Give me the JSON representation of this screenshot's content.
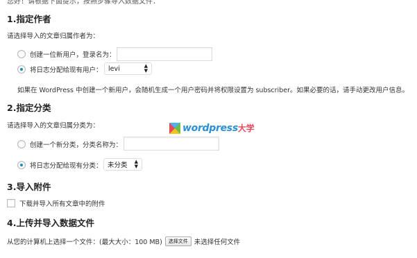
{
  "intro_text": "您好！请根据下面提示，按照步骤导入数据文件：",
  "section1": {
    "title": "1.指定作者",
    "prompt": "请选择导入的文章归属作者为：",
    "option_new_label": "创建一位新用户，登录名为：",
    "option_existing_label": "将日志分配给现有用户：",
    "existing_user_value": "levi",
    "note": "如果在 WordPress 中创建一个新用户，会随机生成一个用户密码并将权限设置为 subscriber。如果必要的话，请手动更改用户信息。"
  },
  "section2": {
    "title": "2.指定分类",
    "prompt": "请选择导入的文章归属分类为：",
    "option_new_label": "创建一个新分类，分类名称为：",
    "option_existing_label": "将日志分配给现有分类：",
    "existing_category_value": "未分类"
  },
  "section3": {
    "title": "3.导入附件",
    "checkbox_label": "下载并导入所有文章中的附件"
  },
  "section4": {
    "title": "4.上传并导入数据文件",
    "file_prompt": "从您的计算机上选择一个文件：(最大大小：100 MB)",
    "file_button": "选择文件",
    "file_status": "未选择任何文件"
  },
  "watermark": {
    "text": "wordpress",
    "text_cn": "大学",
    "icon": "wordpress-daxue-logo-icon"
  },
  "colors": {
    "radio_checked": "#1e8cbe",
    "watermark_blue": "#2b8fd6",
    "watermark_red": "#e94a5a"
  }
}
